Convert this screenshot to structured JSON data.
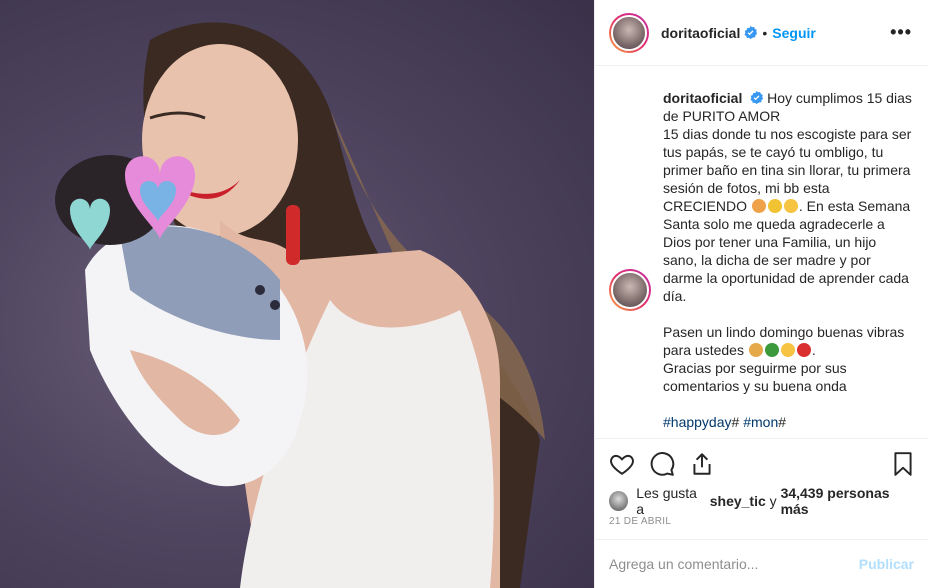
{
  "post": {
    "username": "doritaoficial",
    "follow_label": "Seguir",
    "separator": "•",
    "more_label": "•••"
  },
  "caption": {
    "username": "doritaoficial",
    "line1": "Hoy cumplimos 15 dias de PURITO AMOR",
    "line2": "15 dias donde tu nos escogiste para ser tus papás, se te cayó tu ombligo, tu primer baño en tina sin llorar, tu primera sesión de fotos, mi bb esta CRECIENDO",
    "line2b": ". En esta Semana Santa solo me queda agradecerle a Dios por tener una Familia, un hijo sano, la dicha de ser madre y por darme la oportunidad de aprender cada día.",
    "line3": "Pasen un lindo domingo buenas vibras para ustedes",
    "line3b": ".",
    "line4": "Gracias por seguirme por sus comentarios y su buena onda",
    "hashtag1": "#happyday",
    "hash_sep1": "#",
    "hashtag2": "#mon",
    "hash_sep2": "#"
  },
  "likes": {
    "prefix": "Les gusta a",
    "user": "shey_tic",
    "connector": "y",
    "count": "34,439 personas más"
  },
  "date": "21 DE ABRIL",
  "comment_box": {
    "placeholder": "Agrega un comentario...",
    "publish_label": "Publicar"
  },
  "icons": [
    "heart-icon",
    "comment-icon",
    "share-icon",
    "bookmark-icon",
    "verified-badge-icon",
    "more-options-icon"
  ],
  "colors": {
    "accent": "#0095f6",
    "publish_disabled": "#b2dffc",
    "hashtag": "#00376b",
    "muted": "#8e8e8e"
  }
}
